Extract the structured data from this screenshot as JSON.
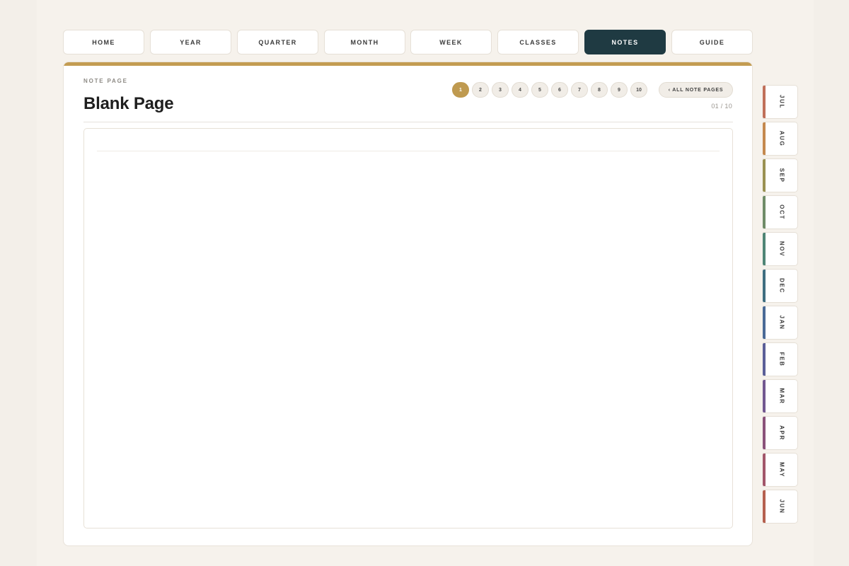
{
  "nav": {
    "items": [
      {
        "label": "HOME",
        "active": false
      },
      {
        "label": "YEAR",
        "active": false
      },
      {
        "label": "QUARTER",
        "active": false
      },
      {
        "label": "MONTH",
        "active": false
      },
      {
        "label": "WEEK",
        "active": false
      },
      {
        "label": "CLASSES",
        "active": false
      },
      {
        "label": "NOTES",
        "active": true
      },
      {
        "label": "GUIDE",
        "active": false
      }
    ]
  },
  "page": {
    "eyebrow": "NOTE PAGE",
    "title": "Blank Page",
    "counter": "01 / 10",
    "all_button_label": "‹ ALL NOTE PAGES"
  },
  "pager": {
    "current": 1,
    "pages": [
      "1",
      "2",
      "3",
      "4",
      "5",
      "6",
      "7",
      "8",
      "9",
      "10"
    ]
  },
  "months": [
    {
      "label": "JUL",
      "color": "#c0705a"
    },
    {
      "label": "AUG",
      "color": "#c4894e"
    },
    {
      "label": "SEP",
      "color": "#9a9152"
    },
    {
      "label": "OCT",
      "color": "#6f8c68"
    },
    {
      "label": "NOV",
      "color": "#4f8575"
    },
    {
      "label": "DEC",
      "color": "#3f6e80"
    },
    {
      "label": "JAN",
      "color": "#4a6a96"
    },
    {
      "label": "FEB",
      "color": "#5b5f98"
    },
    {
      "label": "MAR",
      "color": "#725890"
    },
    {
      "label": "APR",
      "color": "#8a527a"
    },
    {
      "label": "MAY",
      "color": "#a2566a"
    },
    {
      "label": "JUN",
      "color": "#b5604f"
    }
  ],
  "colors": {
    "accent_gold": "#c39c52",
    "active_nav": "#1f3a42"
  }
}
